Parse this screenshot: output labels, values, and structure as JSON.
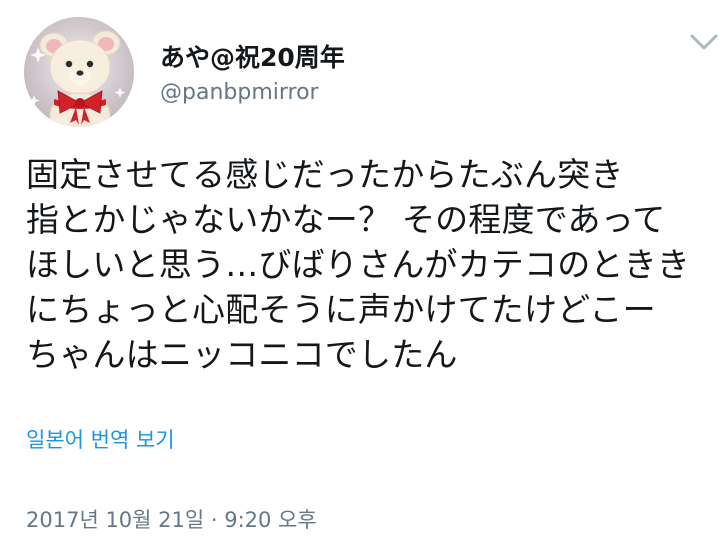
{
  "tweet": {
    "author": {
      "display_name": "あや@祝20周年",
      "handle": "@panbpmirror",
      "avatar_icon": "teddy-bear-with-red-ribbon-avatar"
    },
    "menu_icon": "chevron-down-icon",
    "text_lines": [
      "固定させてる感じだったからたぶん突き",
      "指とかじゃないかなー？ その程度であって",
      "ほしいと思う…びばりさんがカテコのときき",
      "にちょっと心配そうに声かけてたけどこー",
      "ちゃんはニッコニコでしたん"
    ],
    "translate_label": "일본어 번역 보기",
    "timestamp": "2017년 10월 21일 · 9:20 오후"
  },
  "colors": {
    "text": "#14171a",
    "secondary": "#657786",
    "link": "#1b95e0",
    "ribbon": "#d4202a"
  }
}
